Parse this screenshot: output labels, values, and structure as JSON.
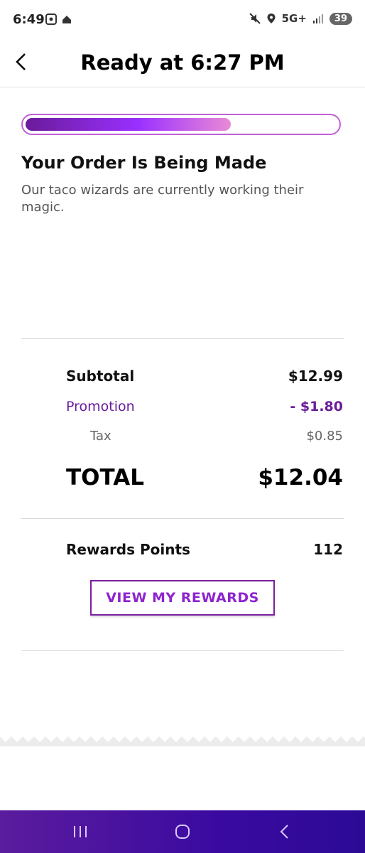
{
  "status_bar": {
    "time": "6:49",
    "network": "5G+",
    "battery": "39"
  },
  "header": {
    "title": "Ready at 6:27 PM"
  },
  "order_status": {
    "progress_fraction": 0.66,
    "heading": "Your Order Is Being Made",
    "description": "Our taco wizards are currently working their magic."
  },
  "summary": {
    "subtotal_label": "Subtotal",
    "subtotal_value": "$12.99",
    "promotion_label": "Promotion",
    "promotion_value": "- $1.80",
    "tax_label": "Tax",
    "tax_value": "$0.85",
    "total_label": "TOTAL",
    "total_value": "$12.04"
  },
  "rewards": {
    "label": "Rewards Points",
    "value": "112",
    "button_label": "VIEW MY REWARDS"
  },
  "colors": {
    "accent": "#7b1fa2",
    "nav_bar": "#3a0aa0"
  },
  "icons": {
    "back": "chevron-left-icon",
    "nav_recent": "recent-apps-icon",
    "nav_home": "home-circle-icon",
    "nav_back": "chevron-left-icon"
  }
}
